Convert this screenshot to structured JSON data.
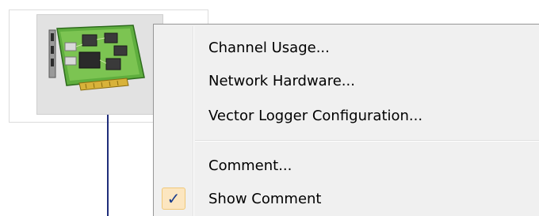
{
  "diagram": {
    "node_icon": "network-interface-card-icon",
    "connector_color": "#1f2d7a"
  },
  "context_menu": {
    "items": [
      {
        "label": "Channel Usage...",
        "checked": false
      },
      {
        "label": "Network Hardware...",
        "checked": false
      },
      {
        "label": "Vector Logger Configuration...",
        "checked": false
      },
      {
        "label": "Comment...",
        "checked": false
      },
      {
        "label": "Show Comment",
        "checked": true
      }
    ],
    "check_glyph": "✓",
    "check_icon": "checkmark-icon"
  }
}
